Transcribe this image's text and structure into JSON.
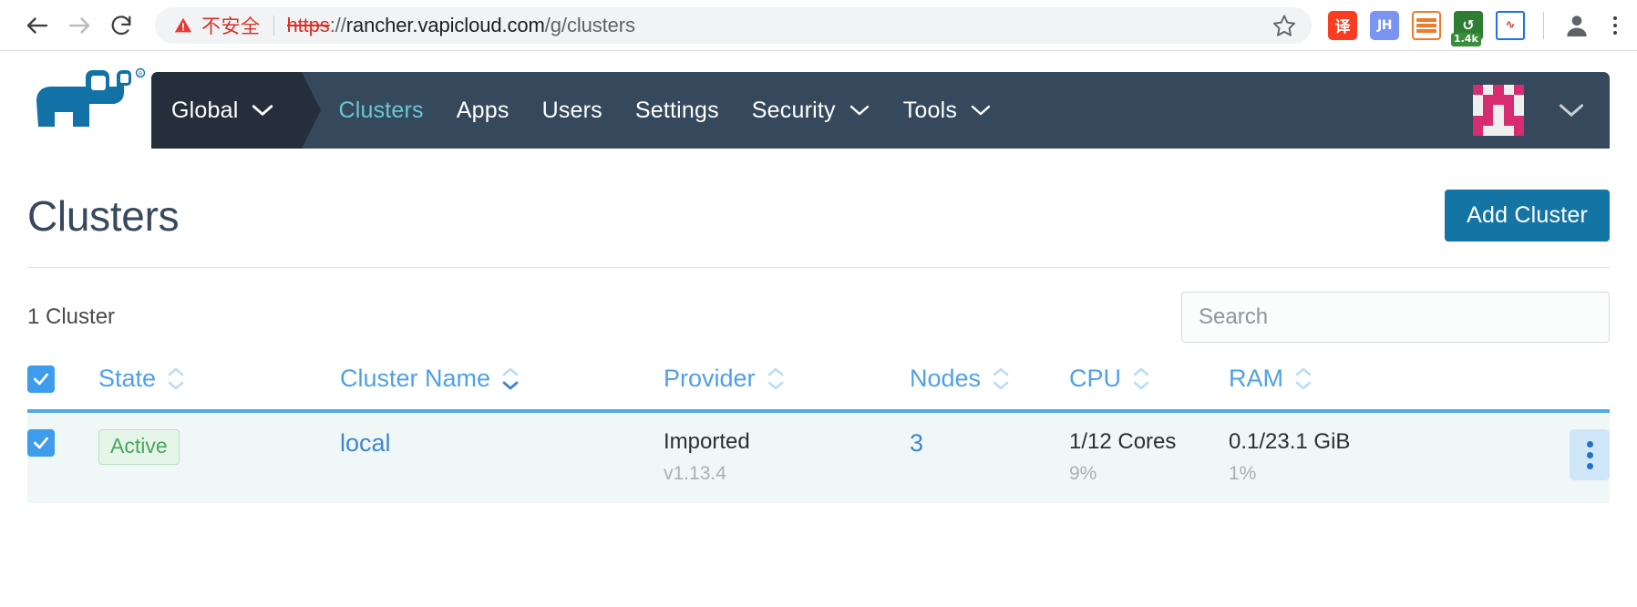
{
  "browser": {
    "back_icon": "arrow-left-icon",
    "forward_icon": "arrow-right-icon",
    "reload_icon": "reload-icon",
    "security_label": "不安全",
    "url_scheme": "https",
    "url_colon": "://",
    "url_host": "rancher.vapicloud.com",
    "url_path": "/g/clusters",
    "bookmark_icon": "star-icon",
    "extensions": [
      {
        "name": "youdao-dictionary-extension",
        "glyph": "译"
      },
      {
        "name": "jianghu-extension",
        "glyph": "JH"
      },
      {
        "name": "list-extension",
        "glyph": ""
      },
      {
        "name": "session-restore-extension",
        "glyph": "↺",
        "badge": "1.4k"
      },
      {
        "name": "monitor-extension",
        "glyph": "∿"
      }
    ],
    "profile_icon": "account-circle-icon",
    "menu_icon": "three-dot-menu-icon"
  },
  "navbar": {
    "logo": "rancher-cow-logo",
    "scope": "Global",
    "scope_chevron": "chevron-down-icon",
    "items": [
      {
        "label": "Clusters",
        "active": true,
        "caret": false
      },
      {
        "label": "Apps",
        "active": false,
        "caret": false
      },
      {
        "label": "Users",
        "active": false,
        "caret": false
      },
      {
        "label": "Settings",
        "active": false,
        "caret": false
      },
      {
        "label": "Security",
        "active": false,
        "caret": true
      },
      {
        "label": "Tools",
        "active": false,
        "caret": true
      }
    ],
    "avatar": "user-identicon-avatar",
    "avatar_chevron": "chevron-down-icon",
    "avatar_color": "#d72c72",
    "avatar_pattern": [
      [
        1,
        0,
        1,
        0,
        1
      ],
      [
        0,
        1,
        1,
        1,
        0
      ],
      [
        0,
        1,
        0,
        1,
        0
      ],
      [
        1,
        1,
        0,
        1,
        1
      ],
      [
        1,
        0,
        0,
        0,
        1
      ]
    ]
  },
  "page": {
    "title": "Clusters",
    "add_button": "Add Cluster",
    "count_label": "1 Cluster",
    "search_placeholder": "Search",
    "search_value": ""
  },
  "table": {
    "columns": [
      {
        "label": "State",
        "sort": "none"
      },
      {
        "label": "Cluster Name",
        "sort": "desc"
      },
      {
        "label": "Provider",
        "sort": "none"
      },
      {
        "label": "Nodes",
        "sort": "none"
      },
      {
        "label": "CPU",
        "sort": "none"
      },
      {
        "label": "RAM",
        "sort": "none"
      }
    ],
    "header_checkbox_checked": true,
    "rows": [
      {
        "checked": true,
        "state": "Active",
        "name": "local",
        "provider": "Imported",
        "provider_sub": "v1.13.4",
        "nodes": "3",
        "cpu": "1/12 Cores",
        "cpu_sub": "9%",
        "ram": "0.1/23.1 GiB",
        "ram_sub": "1%",
        "actions_icon": "row-actions-kebab-icon"
      }
    ]
  },
  "colors": {
    "navbar_bg": "#36495c",
    "scope_bg": "#242f3b",
    "accent_link": "#50a1e5",
    "primary_button": "#1474a4",
    "active_badge": "#46a75e",
    "row_bg": "#eff7f7"
  }
}
